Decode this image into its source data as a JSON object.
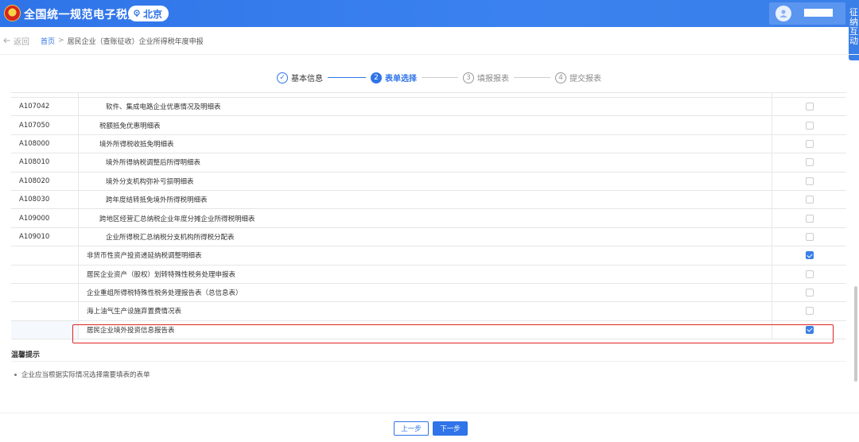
{
  "header": {
    "site_title": "全国统一规范电子税务局",
    "region": "北京",
    "side_tab": "征纳互动",
    "brand_color": "#2f74e8"
  },
  "breadcrumb": {
    "back": "返回",
    "home": "首页",
    "separator": ">",
    "current": "居民企业（查账征收）企业所得税年度申报"
  },
  "steps": [
    {
      "num": "1",
      "label": "基本信息",
      "state": "done"
    },
    {
      "num": "2",
      "label": "表单选择",
      "state": "active"
    },
    {
      "num": "3",
      "label": "填报报表",
      "state": "todo"
    },
    {
      "num": "4",
      "label": "提交报表",
      "state": "todo"
    }
  ],
  "table": {
    "rows": [
      {
        "code": "A107042",
        "name": "软件、集成电路企业优惠情况及明细表",
        "indent": 2,
        "checked": false
      },
      {
        "code": "A107050",
        "name": "税额抵免优惠明细表",
        "indent": 1,
        "checked": false
      },
      {
        "code": "A108000",
        "name": "境外所得税收抵免明细表",
        "indent": 1,
        "checked": false
      },
      {
        "code": "A108010",
        "name": "境外所得纳税调整后所得明细表",
        "indent": 2,
        "checked": false
      },
      {
        "code": "A108020",
        "name": "境外分支机构弥补亏损明细表",
        "indent": 2,
        "checked": false
      },
      {
        "code": "A108030",
        "name": "跨年度结转抵免境外所得税明细表",
        "indent": 2,
        "checked": false
      },
      {
        "code": "A109000",
        "name": "跨地区经营汇总纳税企业年度分摊企业所得税明细表",
        "indent": 1,
        "checked": false
      },
      {
        "code": "A109010",
        "name": "企业所得税汇总纳税分支机构所得税分配表",
        "indent": 2,
        "checked": false
      },
      {
        "code": "",
        "name": "非货币性资产投资递延纳税调整明细表",
        "indent": 0,
        "checked": true
      },
      {
        "code": "",
        "name": "居民企业资产（股权）划转特殊性税务处理申报表",
        "indent": 0,
        "checked": false
      },
      {
        "code": "",
        "name": "企业重组所得税特殊性税务处理报告表（总信息表）",
        "indent": 0,
        "checked": false
      },
      {
        "code": "",
        "name": "海上油气生产设施弃置费情况表",
        "indent": 0,
        "checked": false
      },
      {
        "code": "",
        "name": "居民企业境外投资信息报告表",
        "indent": 0,
        "checked": true
      }
    ]
  },
  "tips": {
    "title": "温馨提示",
    "items": [
      "企业应当根据实际情况选择需要填表的表单"
    ]
  },
  "footer": {
    "prev": "上一步",
    "next": "下一步"
  }
}
